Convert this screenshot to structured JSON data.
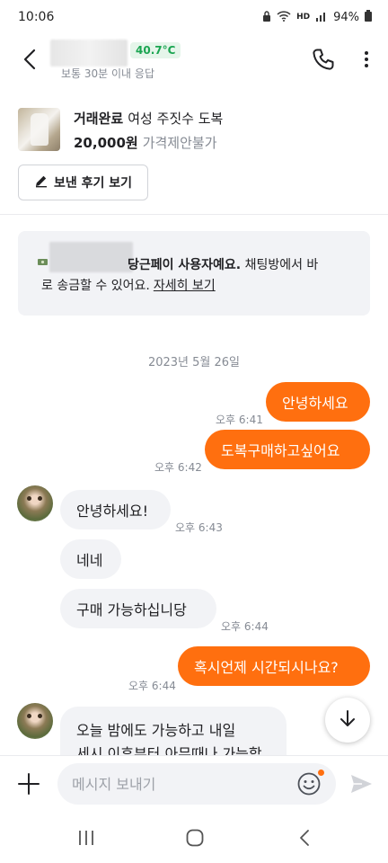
{
  "status_bar": {
    "time": "10:06",
    "battery": "94%",
    "net": "HD"
  },
  "header": {
    "temperature": "40.7°C",
    "response_time": "보통 30분 이내 응답"
  },
  "product": {
    "status": "거래완료",
    "title": "여성 주짓수 도복",
    "price": "20,000원",
    "price_note": "가격제안불가"
  },
  "review_button": {
    "label": "보낸 후기 보기"
  },
  "pay_notice": {
    "text_bold": "당근페이 사용자예요.",
    "text_rest": "채팅방에서 바",
    "text_line2": "로 송금할 수 있어요.",
    "link": "자세히 보기"
  },
  "chat": {
    "date": "2023년 5월 26일",
    "messages": [
      {
        "from": "me",
        "text": "안녕하세요",
        "time": "오후 6:41"
      },
      {
        "from": "me",
        "text": "도복구매하고싶어요",
        "time": "오후 6:42"
      },
      {
        "from": "them",
        "text": "안녕하세요!",
        "time": "오후 6:43"
      },
      {
        "from": "them",
        "text": "네네",
        "time": ""
      },
      {
        "from": "them",
        "text": "구매 가능하십니당",
        "time": "오후 6:44"
      },
      {
        "from": "me",
        "text": "혹시언제 시간되시나요?",
        "time": "오후 6:44"
      },
      {
        "from": "them",
        "text_line1": "오늘 밤에도 가능하고 내일",
        "text_line2": "세시 이후부터 아무때나 가능합",
        "time": ""
      }
    ]
  },
  "input": {
    "placeholder": "메시지 보내기"
  },
  "colors": {
    "accent": "#ff6f0f",
    "temperature_green": "#1aa551",
    "bubble_gray": "#f2f3f6"
  }
}
